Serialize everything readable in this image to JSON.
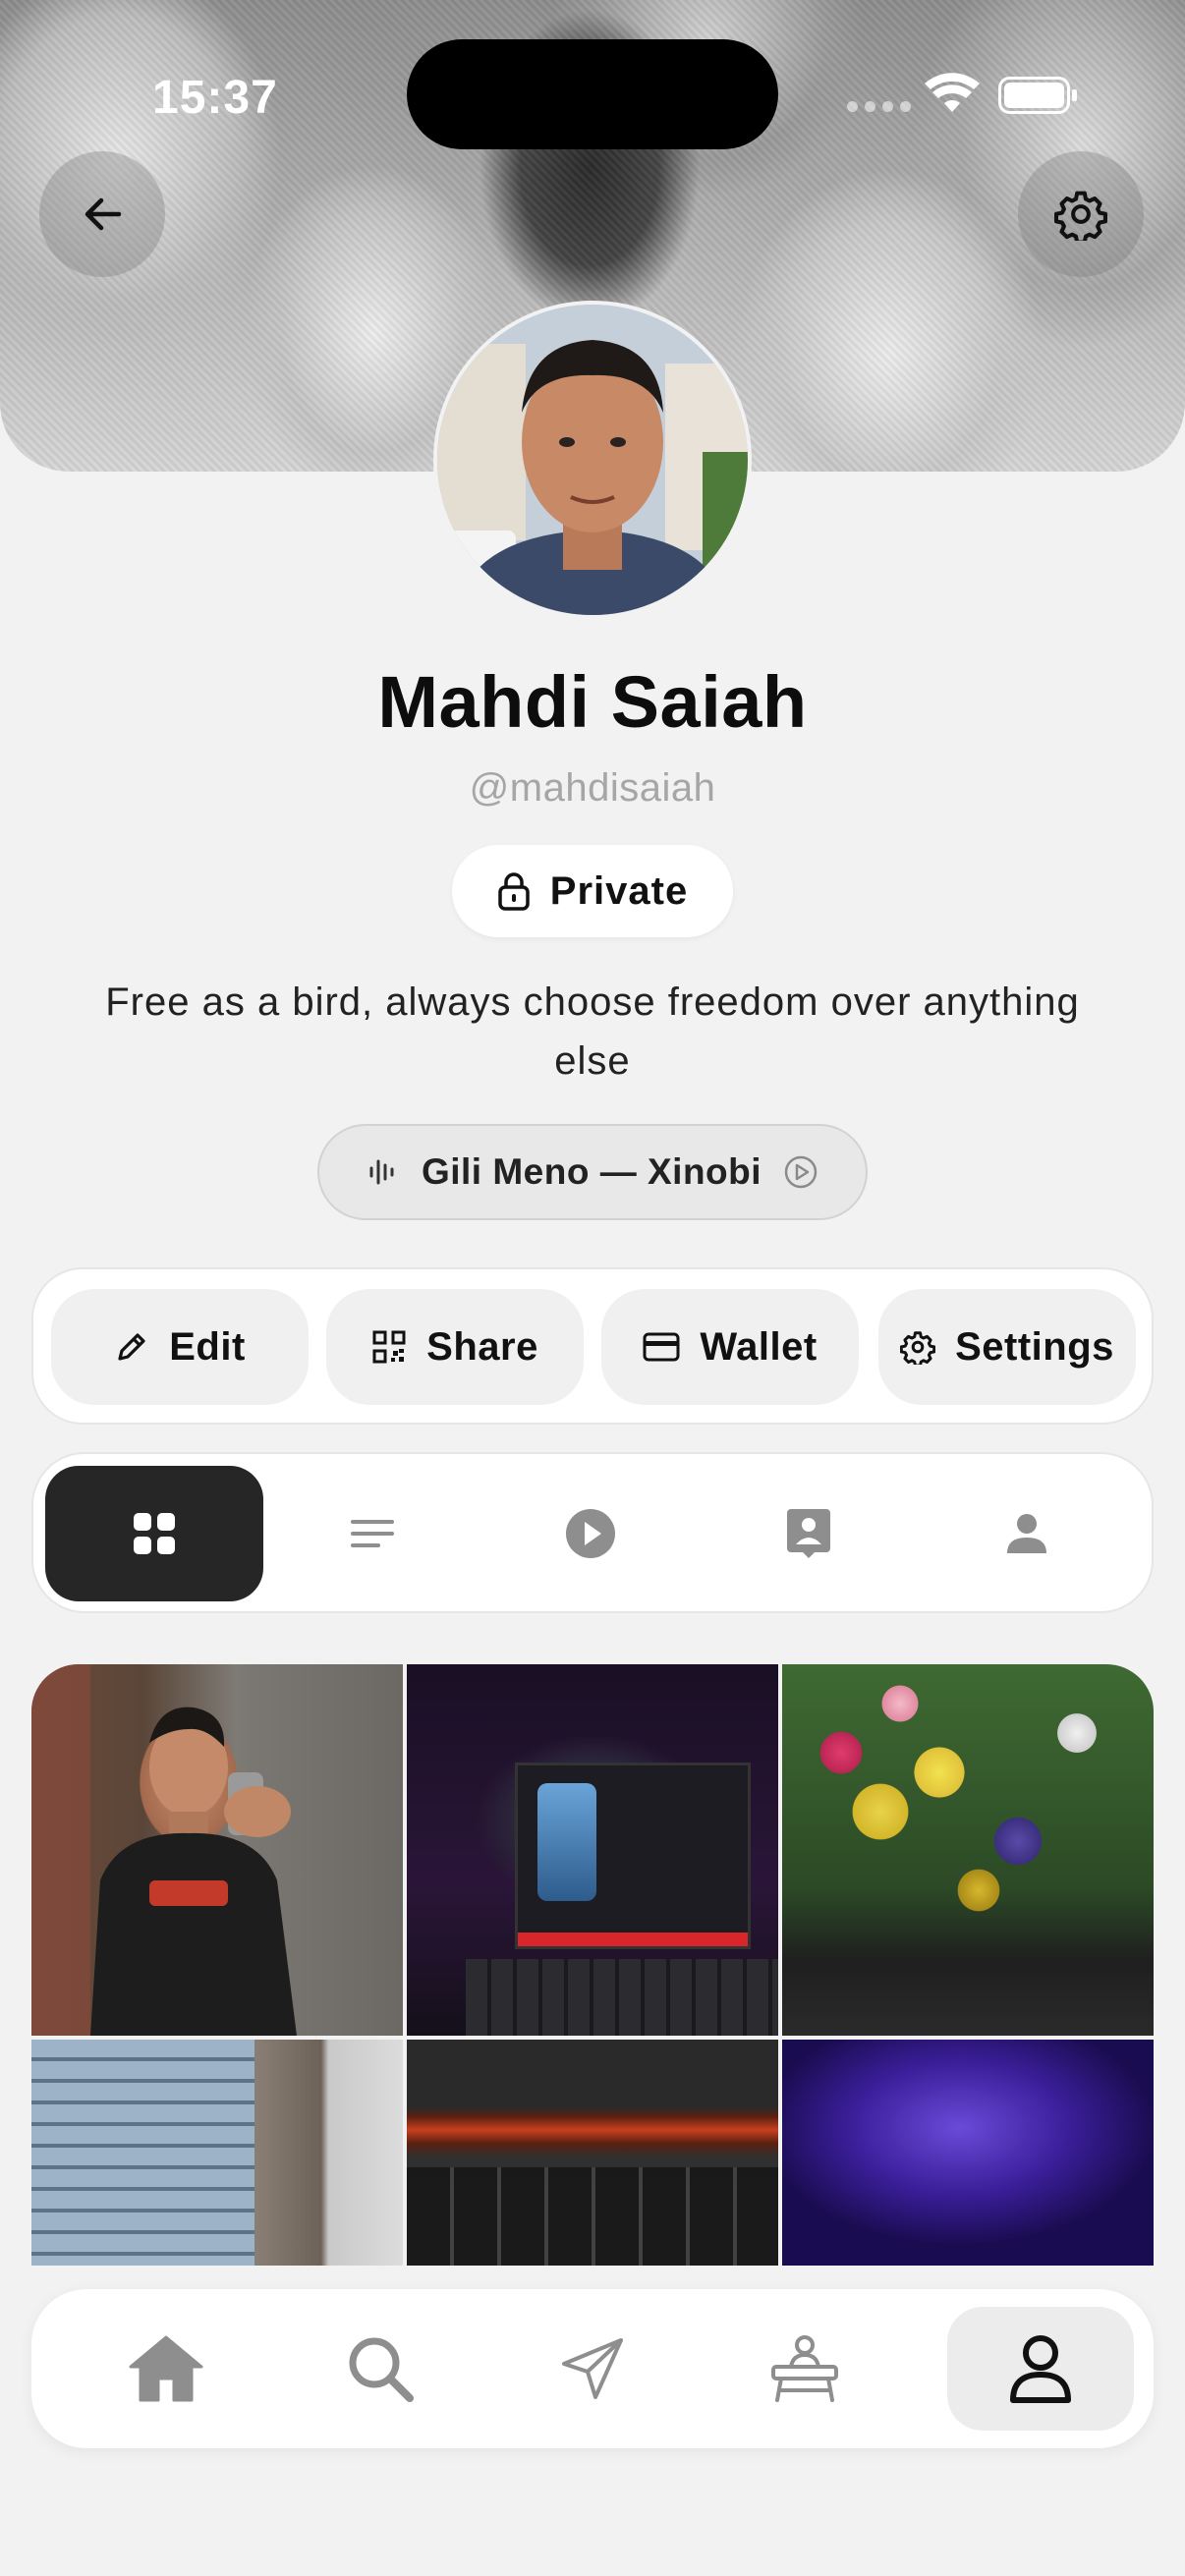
{
  "status_bar": {
    "time": "15:37"
  },
  "header": {
    "back_icon": "arrow-left-icon",
    "settings_icon": "gear-icon"
  },
  "profile": {
    "name": "Mahdi Saiah",
    "handle": "@mahdisaiah",
    "privacy_label": "Private",
    "bio": "Free as a bird, always choose freedom over anything else",
    "music_label": "Gili Meno — Xinobi"
  },
  "actions": [
    {
      "label": "Edit",
      "icon": "pencil-icon"
    },
    {
      "label": "Share",
      "icon": "qr-code-icon"
    },
    {
      "label": "Wallet",
      "icon": "credit-card-icon"
    },
    {
      "label": "Settings",
      "icon": "gear-icon"
    }
  ],
  "content_tabs": [
    {
      "name": "grid",
      "icon": "grid-icon",
      "active": true
    },
    {
      "name": "text",
      "icon": "lines-icon",
      "active": false
    },
    {
      "name": "video",
      "icon": "play-circle-icon",
      "active": false
    },
    {
      "name": "contacts",
      "icon": "contact-card-icon",
      "active": false
    },
    {
      "name": "tagged",
      "icon": "person-icon",
      "active": false
    }
  ],
  "bottom_nav": [
    {
      "name": "home",
      "icon": "home-icon",
      "active": false
    },
    {
      "name": "search",
      "icon": "search-icon",
      "active": false
    },
    {
      "name": "messages",
      "icon": "send-icon",
      "active": false
    },
    {
      "name": "workspace",
      "icon": "desk-icon",
      "active": false
    },
    {
      "name": "profile",
      "icon": "user-icon",
      "active": true
    }
  ],
  "colors": {
    "background": "#f2f2f2",
    "active_tab": "#262626",
    "handle_gray": "#a6a6a6"
  }
}
